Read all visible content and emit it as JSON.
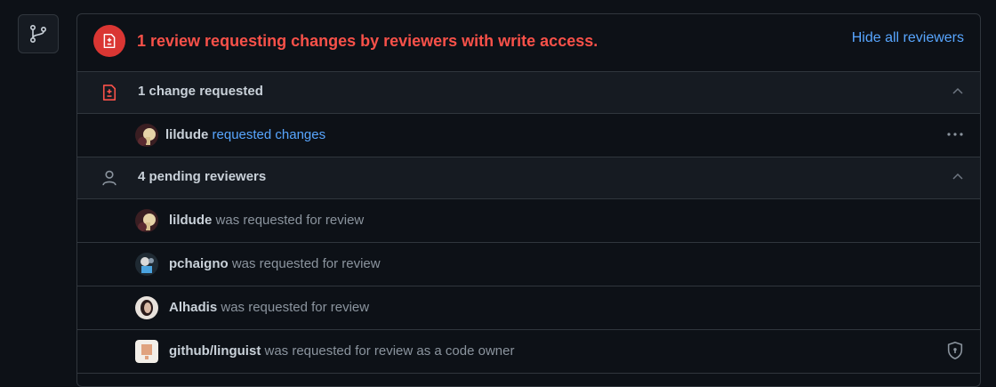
{
  "header": {
    "title": "1 review requesting changes by reviewers with write access.",
    "hide_link": "Hide all reviewers"
  },
  "sections": {
    "changes": {
      "title": "1 change requested",
      "rows": [
        {
          "username": "lildude",
          "action": "requested changes"
        }
      ]
    },
    "pending": {
      "title": "4 pending reviewers",
      "rows": [
        {
          "username": "lildude",
          "action": "was requested for review"
        },
        {
          "username": "pchaigno",
          "action": "was requested for review"
        },
        {
          "username": "Alhadis",
          "action": "was requested for review"
        },
        {
          "username": "github/linguist",
          "action": "was requested for review as a code owner"
        }
      ]
    }
  },
  "colors": {
    "danger": "#f85149",
    "link": "#58a6ff",
    "muted": "#8b949e",
    "bg": "#0d1117",
    "border": "#30363d"
  },
  "icons": {
    "branch": "git-branch-icon",
    "file_diff": "file-diff-icon",
    "person": "person-icon",
    "chevron": "chevron-up-icon",
    "kebab": "kebab-horizontal-icon",
    "shield": "shield-lock-icon"
  }
}
